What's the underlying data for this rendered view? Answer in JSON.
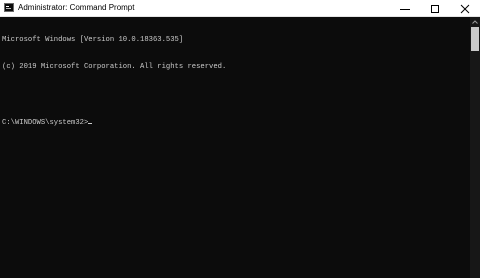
{
  "window": {
    "title": "Administrator: Command Prompt",
    "app_icon": "cmd-icon",
    "controls": [
      "minimize-icon",
      "maximize-icon",
      "close-icon"
    ]
  },
  "console": {
    "lines": [
      "Microsoft Windows [Version 10.0.18363.535]",
      "(c) 2019 Microsoft Corporation. All rights reserved.",
      "",
      "C:\\WINDOWS\\system32>"
    ]
  },
  "colors": {
    "console_background": "#0c0c0c",
    "console_text": "#cccccc",
    "titlebar_background": "#ffffff"
  }
}
